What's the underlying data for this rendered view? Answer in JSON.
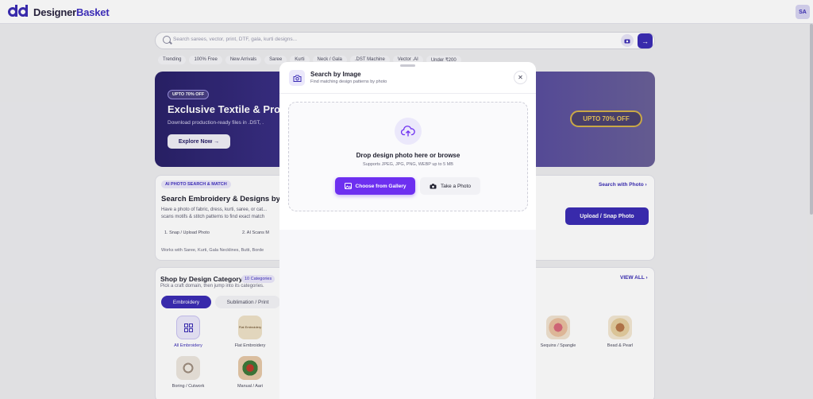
{
  "header": {
    "logo_prefix": "Designer",
    "logo_suffix": "Basket",
    "avatar_initials": "SA"
  },
  "search": {
    "placeholder": "Search sarees, vector, print, DTF, gala, kurti designs..."
  },
  "chips": [
    "Trending",
    "100% Free",
    "New Arrivals",
    "Saree",
    "Kurti",
    "Neck / Gala",
    ".DST Machine",
    "Vector .AI",
    "Under ₹200"
  ],
  "banner": {
    "badge": "UPTO 70% OFF",
    "title": "Exclusive Textile & Pro",
    "subtitle": "Download production-ready files in .DST, .",
    "button": "Explore Now →",
    "pill": "UPTO 70% OFF"
  },
  "ai_section": {
    "badge": "AI PHOTO SEARCH & MATCH",
    "title": "Search Embroidery & Designs by",
    "description": "Have a photo of fabric, dress, kurti, saree, or cat... scans motifs & stitch patterns to find exact match",
    "steps": [
      "1. Snap / Upload Photo",
      "2. AI Scans M"
    ],
    "note": "Works with Saree, Kurti, Gala Necklines, Butti, Borde",
    "link": "Search with Photo ›",
    "button": "Upload / Snap Photo"
  },
  "categories": {
    "title": "Shop by Design Category",
    "badge": "10 Categories",
    "subtitle": "Pick a craft domain, then jump into its categories.",
    "view_all": "VIEW ALL ›",
    "tabs": [
      "Embroidery",
      "Sublimation / Print"
    ],
    "items": [
      {
        "label": "All Embroidery"
      },
      {
        "label": "Flat Embroidery"
      },
      {
        "label": "Sequins / Spangle"
      },
      {
        "label": "Bead & Pearl"
      },
      {
        "label": "Boring / Cutwork"
      },
      {
        "label": "Manual / Aari"
      }
    ],
    "flat_embroidery_tile_text": "Flat Embroidery"
  },
  "modal": {
    "title": "Search by Image",
    "subtitle": "Find matching design patterns by photo",
    "drop_title": "Drop design photo here or browse",
    "drop_sub": "Supports JPEG, JPG, PNG, WEBP up to 5 MB",
    "gallery_button": "Choose from Gallery",
    "photo_button": "Take a Photo"
  },
  "colors": {
    "brand": "#3b2db5",
    "accent": "#6d2ff0",
    "banner_pill": "#e9c55a"
  }
}
